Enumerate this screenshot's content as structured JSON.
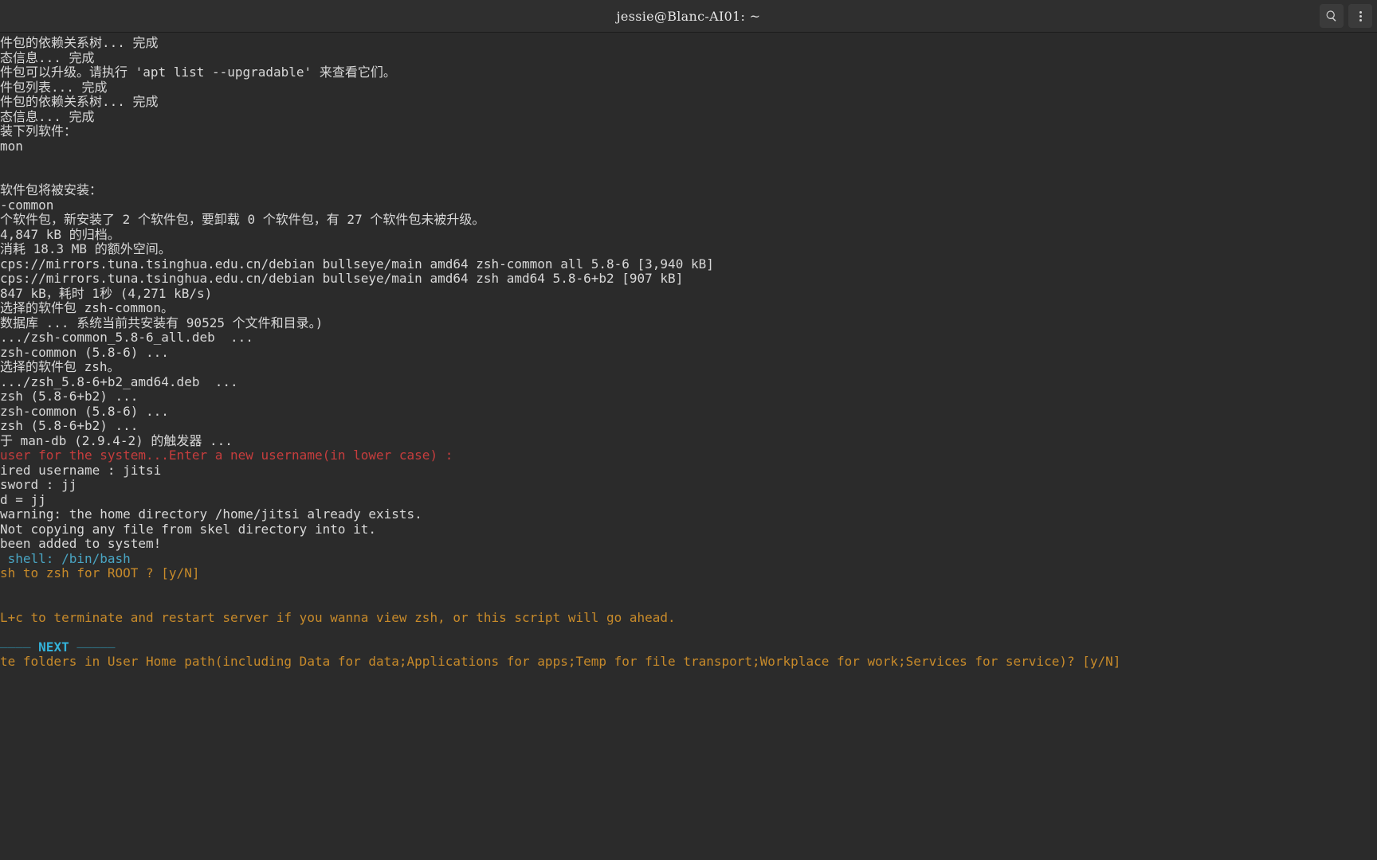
{
  "window": {
    "title": "jessie@Blanc-AI01: ~"
  },
  "terminal": {
    "lines": [
      {
        "class": "c-default",
        "text": "件包的依赖关系树... 完成"
      },
      {
        "class": "c-default",
        "text": "态信息... 完成"
      },
      {
        "class": "c-default",
        "text": "件包可以升级。请执行 'apt list --upgradable' 来查看它们。"
      },
      {
        "class": "c-default",
        "text": "件包列表... 完成"
      },
      {
        "class": "c-default",
        "text": "件包的依赖关系树... 完成"
      },
      {
        "class": "c-default",
        "text": "态信息... 完成"
      },
      {
        "class": "c-default",
        "text": "装下列软件："
      },
      {
        "class": "c-default",
        "text": "mon"
      },
      {
        "class": "c-default",
        "text": ""
      },
      {
        "class": "c-default",
        "text": ""
      },
      {
        "class": "c-default",
        "text": "软件包将被安装："
      },
      {
        "class": "c-default",
        "text": "-common"
      },
      {
        "class": "c-default",
        "text": "个软件包，新安装了 2 个软件包，要卸载 0 个软件包，有 27 个软件包未被升级。"
      },
      {
        "class": "c-default",
        "text": "4,847 kB 的归档。"
      },
      {
        "class": "c-default",
        "text": "消耗 18.3 MB 的额外空间。"
      },
      {
        "class": "c-default",
        "text": "cps://mirrors.tuna.tsinghua.edu.cn/debian bullseye/main amd64 zsh-common all 5.8-6 [3,940 kB]"
      },
      {
        "class": "c-default",
        "text": "cps://mirrors.tuna.tsinghua.edu.cn/debian bullseye/main amd64 zsh amd64 5.8-6+b2 [907 kB]"
      },
      {
        "class": "c-default",
        "text": "847 kB，耗时 1秒 (4,271 kB/s)"
      },
      {
        "class": "c-default",
        "text": "选择的软件包 zsh-common。"
      },
      {
        "class": "c-default",
        "text": "数据库 ... 系统当前共安装有 90525 个文件和目录。)"
      },
      {
        "class": "c-default",
        "text": ".../zsh-common_5.8-6_all.deb  ..."
      },
      {
        "class": "c-default",
        "text": "zsh-common (5.8-6) ..."
      },
      {
        "class": "c-default",
        "text": "选择的软件包 zsh。"
      },
      {
        "class": "c-default",
        "text": ".../zsh_5.8-6+b2_amd64.deb  ..."
      },
      {
        "class": "c-default",
        "text": "zsh (5.8-6+b2) ..."
      },
      {
        "class": "c-default",
        "text": "zsh-common (5.8-6) ..."
      },
      {
        "class": "c-default",
        "text": "zsh (5.8-6+b2) ..."
      },
      {
        "class": "c-default",
        "text": "于 man-db (2.9.4-2) 的触发器 ..."
      },
      {
        "class": "c-red",
        "text": "user for the system...Enter a new username(in lower case) :"
      },
      {
        "class": "c-default",
        "text": "ired username : jitsi"
      },
      {
        "class": "c-default",
        "text": "sword : jj"
      },
      {
        "class": "c-default",
        "text": "d = jj"
      },
      {
        "class": "c-default",
        "text": "warning: the home directory /home/jitsi already exists."
      },
      {
        "class": "c-default",
        "text": "Not copying any file from skel directory into it."
      },
      {
        "class": "c-default",
        "text": "been added to system!"
      },
      {
        "class": "c-cyan",
        "text": " shell: /bin/bash"
      },
      {
        "class": "c-orange",
        "text": "sh to zsh for ROOT ? [y/N]"
      },
      {
        "class": "c-default",
        "text": ""
      },
      {
        "class": "c-default",
        "text": ""
      },
      {
        "class": "c-orange",
        "text": "L+c to terminate and restart server if you wanna view zsh, or this script will go ahead."
      },
      {
        "class": "c-default",
        "text": ""
      },
      {
        "class": "next-row",
        "text": ""
      },
      {
        "class": "c-orange",
        "text": "te folders in User Home path(including Data for data;Applications for apps;Temp for file transport;Workplace for work;Services for service)? [y/N]"
      }
    ],
    "next_marker": {
      "dash_left": "———— ",
      "label": "NEXT",
      "dash_right": " —————"
    }
  }
}
